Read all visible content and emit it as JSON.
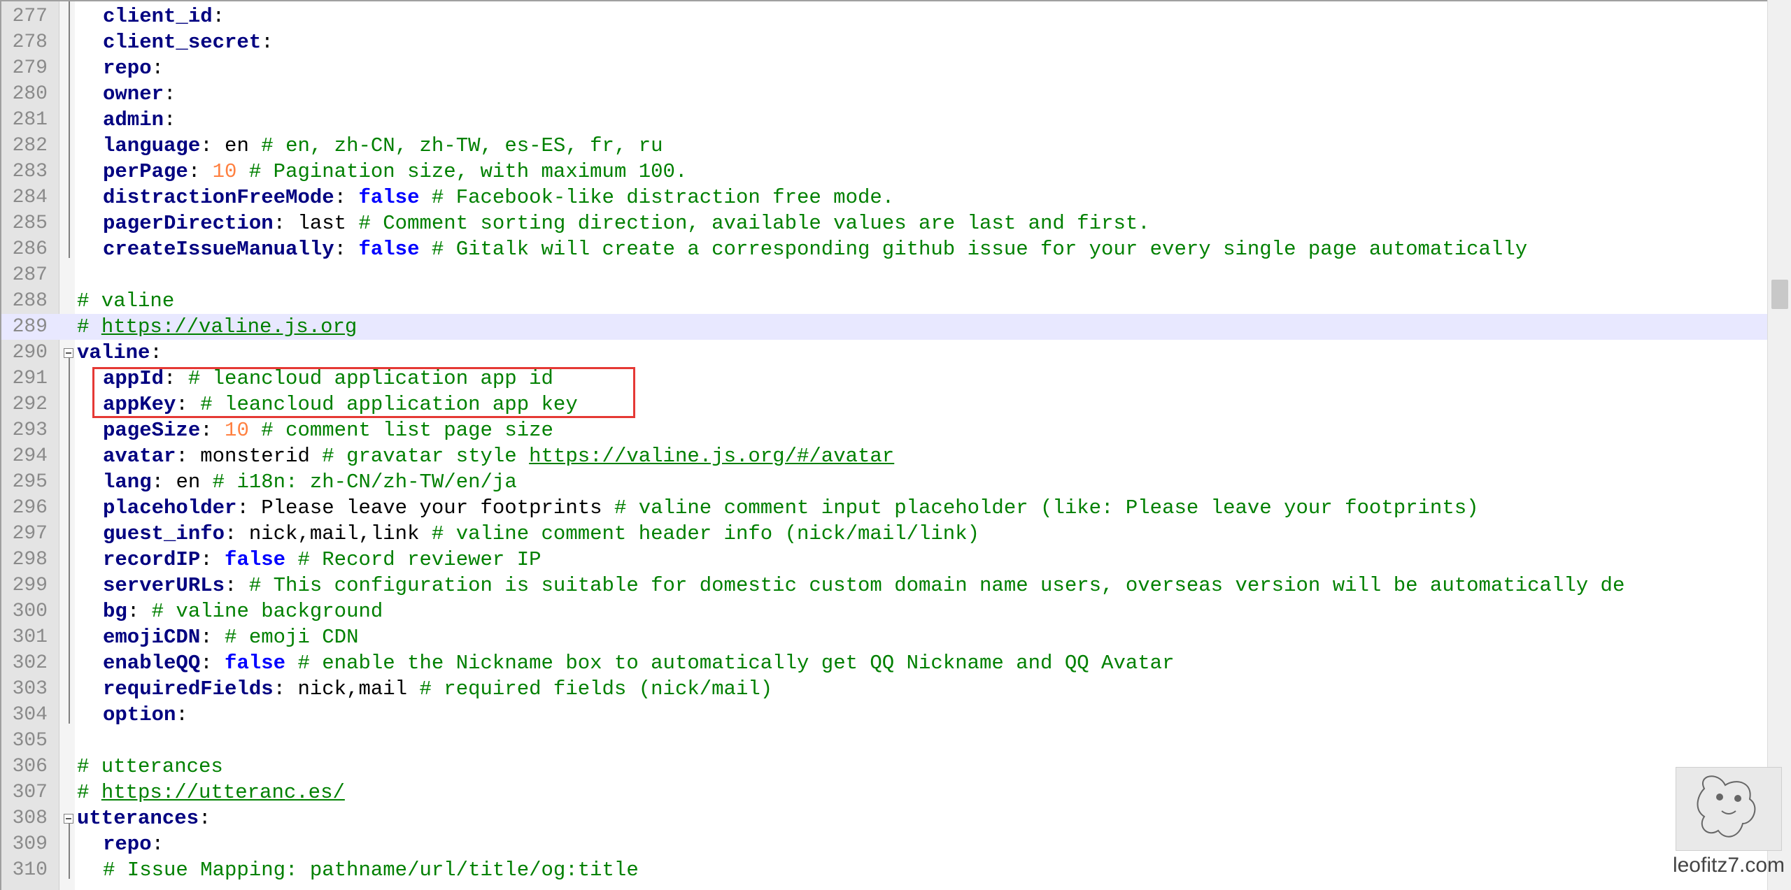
{
  "editor": {
    "lines": [
      {
        "n": "277",
        "indent": 1,
        "tokens": [
          {
            "t": "k",
            "v": "client_id"
          },
          {
            "t": "p",
            "v": ":"
          }
        ]
      },
      {
        "n": "278",
        "indent": 1,
        "tokens": [
          {
            "t": "k",
            "v": "client_secret"
          },
          {
            "t": "p",
            "v": ":"
          }
        ]
      },
      {
        "n": "279",
        "indent": 1,
        "tokens": [
          {
            "t": "k",
            "v": "repo"
          },
          {
            "t": "p",
            "v": ":"
          }
        ]
      },
      {
        "n": "280",
        "indent": 1,
        "tokens": [
          {
            "t": "k",
            "v": "owner"
          },
          {
            "t": "p",
            "v": ":"
          }
        ]
      },
      {
        "n": "281",
        "indent": 1,
        "tokens": [
          {
            "t": "k",
            "v": "admin"
          },
          {
            "t": "p",
            "v": ":"
          }
        ]
      },
      {
        "n": "282",
        "indent": 1,
        "tokens": [
          {
            "t": "k",
            "v": "language"
          },
          {
            "t": "p",
            "v": ": "
          },
          {
            "t": "v",
            "v": "en "
          },
          {
            "t": "c",
            "v": "# en, zh-CN, zh-TW, es-ES, fr, ru"
          }
        ]
      },
      {
        "n": "283",
        "indent": 1,
        "tokens": [
          {
            "t": "k",
            "v": "perPage"
          },
          {
            "t": "p",
            "v": ": "
          },
          {
            "t": "n",
            "v": "10"
          },
          {
            "t": "c",
            "v": " # Pagination size, with maximum 100."
          }
        ]
      },
      {
        "n": "284",
        "indent": 1,
        "tokens": [
          {
            "t": "k",
            "v": "distractionFreeMode"
          },
          {
            "t": "p",
            "v": ": "
          },
          {
            "t": "b",
            "v": "false"
          },
          {
            "t": "c",
            "v": " # Facebook-like distraction free mode."
          }
        ]
      },
      {
        "n": "285",
        "indent": 1,
        "tokens": [
          {
            "t": "k",
            "v": "pagerDirection"
          },
          {
            "t": "p",
            "v": ": "
          },
          {
            "t": "v",
            "v": "last "
          },
          {
            "t": "c",
            "v": "# Comment sorting direction, available values are last and first."
          }
        ]
      },
      {
        "n": "286",
        "indent": 1,
        "tokens": [
          {
            "t": "k",
            "v": "createIssueManually"
          },
          {
            "t": "p",
            "v": ": "
          },
          {
            "t": "b",
            "v": "false"
          },
          {
            "t": "c",
            "v": " # Gitalk will create a corresponding github issue for your every single page automatically"
          }
        ]
      },
      {
        "n": "287",
        "indent": 0,
        "tokens": []
      },
      {
        "n": "288",
        "indent": 0,
        "tokens": [
          {
            "t": "c",
            "v": "# valine"
          }
        ]
      },
      {
        "n": "289",
        "indent": 0,
        "highlight": true,
        "tokens": [
          {
            "t": "c",
            "v": "# "
          },
          {
            "t": "u",
            "v": "https://valine.js.org"
          }
        ]
      },
      {
        "n": "290",
        "indent": 0,
        "fold": true,
        "tokens": [
          {
            "t": "k",
            "v": "valine"
          },
          {
            "t": "p",
            "v": ":"
          }
        ]
      },
      {
        "n": "291",
        "indent": 1,
        "tokens": [
          {
            "t": "k",
            "v": "appId"
          },
          {
            "t": "p",
            "v": ": "
          },
          {
            "t": "c",
            "v": "# leancloud application app id"
          }
        ]
      },
      {
        "n": "292",
        "indent": 1,
        "tokens": [
          {
            "t": "k",
            "v": "appKey"
          },
          {
            "t": "p",
            "v": ": "
          },
          {
            "t": "c",
            "v": "# leancloud application app key"
          }
        ]
      },
      {
        "n": "293",
        "indent": 1,
        "tokens": [
          {
            "t": "k",
            "v": "pageSize"
          },
          {
            "t": "p",
            "v": ": "
          },
          {
            "t": "n",
            "v": "10"
          },
          {
            "t": "c",
            "v": " # comment list page size"
          }
        ]
      },
      {
        "n": "294",
        "indent": 1,
        "tokens": [
          {
            "t": "k",
            "v": "avatar"
          },
          {
            "t": "p",
            "v": ": "
          },
          {
            "t": "v",
            "v": "monsterid "
          },
          {
            "t": "c",
            "v": "# gravatar style "
          },
          {
            "t": "u",
            "v": "https://valine.js.org/#/avatar"
          }
        ]
      },
      {
        "n": "295",
        "indent": 1,
        "tokens": [
          {
            "t": "k",
            "v": "lang"
          },
          {
            "t": "p",
            "v": ": "
          },
          {
            "t": "v",
            "v": "en "
          },
          {
            "t": "c",
            "v": "# i18n: zh-CN/zh-TW/en/ja"
          }
        ]
      },
      {
        "n": "296",
        "indent": 1,
        "tokens": [
          {
            "t": "k",
            "v": "placeholder"
          },
          {
            "t": "p",
            "v": ": "
          },
          {
            "t": "v",
            "v": "Please leave your footprints "
          },
          {
            "t": "c",
            "v": "# valine comment input placeholder (like: Please leave your footprints)"
          }
        ]
      },
      {
        "n": "297",
        "indent": 1,
        "tokens": [
          {
            "t": "k",
            "v": "guest_info"
          },
          {
            "t": "p",
            "v": ": "
          },
          {
            "t": "v",
            "v": "nick,mail,link "
          },
          {
            "t": "c",
            "v": "# valine comment header info (nick/mail/link)"
          }
        ]
      },
      {
        "n": "298",
        "indent": 1,
        "tokens": [
          {
            "t": "k",
            "v": "recordIP"
          },
          {
            "t": "p",
            "v": ": "
          },
          {
            "t": "b",
            "v": "false"
          },
          {
            "t": "c",
            "v": " # Record reviewer IP"
          }
        ]
      },
      {
        "n": "299",
        "indent": 1,
        "tokens": [
          {
            "t": "k",
            "v": "serverURLs"
          },
          {
            "t": "p",
            "v": ": "
          },
          {
            "t": "c",
            "v": "# This configuration is suitable for domestic custom domain name users, overseas version will be automatically de"
          }
        ]
      },
      {
        "n": "300",
        "indent": 1,
        "tokens": [
          {
            "t": "k",
            "v": "bg"
          },
          {
            "t": "p",
            "v": ": "
          },
          {
            "t": "c",
            "v": "# valine background"
          }
        ]
      },
      {
        "n": "301",
        "indent": 1,
        "tokens": [
          {
            "t": "k",
            "v": "emojiCDN"
          },
          {
            "t": "p",
            "v": ": "
          },
          {
            "t": "c",
            "v": "# emoji CDN"
          }
        ]
      },
      {
        "n": "302",
        "indent": 1,
        "tokens": [
          {
            "t": "k",
            "v": "enableQQ"
          },
          {
            "t": "p",
            "v": ": "
          },
          {
            "t": "b",
            "v": "false"
          },
          {
            "t": "c",
            "v": " # enable the Nickname box to automatically get QQ Nickname and QQ Avatar"
          }
        ]
      },
      {
        "n": "303",
        "indent": 1,
        "tokens": [
          {
            "t": "k",
            "v": "requiredFields"
          },
          {
            "t": "p",
            "v": ": "
          },
          {
            "t": "v",
            "v": "nick,mail "
          },
          {
            "t": "c",
            "v": "# required fields (nick/mail)"
          }
        ]
      },
      {
        "n": "304",
        "indent": 1,
        "tokens": [
          {
            "t": "k",
            "v": "option"
          },
          {
            "t": "p",
            "v": ":"
          }
        ]
      },
      {
        "n": "305",
        "indent": 0,
        "tokens": []
      },
      {
        "n": "306",
        "indent": 0,
        "tokens": [
          {
            "t": "c",
            "v": "# utterances"
          }
        ]
      },
      {
        "n": "307",
        "indent": 0,
        "tokens": [
          {
            "t": "c",
            "v": "# "
          },
          {
            "t": "u",
            "v": "https://utteranc.es/"
          }
        ]
      },
      {
        "n": "308",
        "indent": 0,
        "fold": true,
        "tokens": [
          {
            "t": "k",
            "v": "utterances"
          },
          {
            "t": "p",
            "v": ":"
          }
        ]
      },
      {
        "n": "309",
        "indent": 1,
        "tokens": [
          {
            "t": "k",
            "v": "repo"
          },
          {
            "t": "p",
            "v": ":"
          }
        ]
      },
      {
        "n": "310",
        "indent": 1,
        "tokens": [
          {
            "t": "c",
            "v": "# Issue Mapping: pathname/url/title/og:title"
          }
        ]
      }
    ]
  },
  "watermark": {
    "text": "leofitz7.com"
  },
  "colors": {
    "key": "#000080",
    "comment": "#008000",
    "number": "#ff8040",
    "boolean": "#0000ff",
    "highlight_box": "#e53935",
    "current_line": "#e8e8ff"
  }
}
